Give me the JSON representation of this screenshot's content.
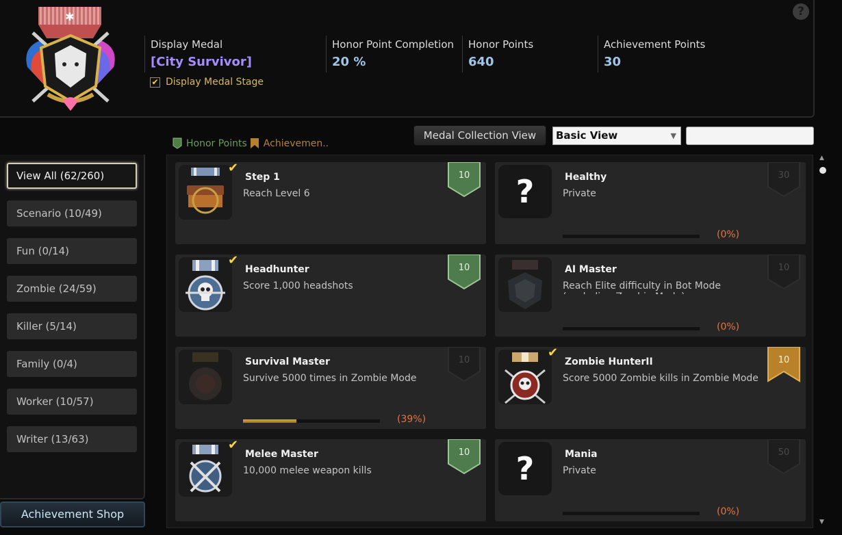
{
  "header": {
    "help_label": "?",
    "display_medal_label": "Display Medal",
    "display_medal_value": "[City Survivor]",
    "display_medal_stage_label": "Display Medal Stage",
    "display_medal_stage_checked": true,
    "honor_completion_label": "Honor Point Completion",
    "honor_completion_value": "20 %",
    "honor_points_label": "Honor Points",
    "honor_points_value": "640",
    "achievement_points_label": "Achievement Points",
    "achievement_points_value": "30"
  },
  "toolbar": {
    "legend_honor": "Honor Points",
    "legend_achievement": "Achievemen..",
    "collection_view_label": "Medal Collection View",
    "view_select_value": "Basic View",
    "search_placeholder": ""
  },
  "sidebar": {
    "categories": [
      {
        "label": "View All (62/260)",
        "active": true
      },
      {
        "label": "Scenario (10/49)"
      },
      {
        "label": "Fun (0/14)"
      },
      {
        "label": "Zombie (24/59)"
      },
      {
        "label": "Killer (5/14)"
      },
      {
        "label": "Family (0/4)"
      },
      {
        "label": "Worker (10/57)"
      },
      {
        "label": "Writer (13/63)"
      }
    ],
    "shop_label": "Achievement Shop"
  },
  "achievements": [
    {
      "title": "Step 1",
      "desc": "Reach Level 6",
      "points": "10",
      "ribbon": "green",
      "completed": true,
      "icon": "welcome-csnz-medal-icon",
      "progress": null,
      "progress_text": ""
    },
    {
      "title": "Healthy",
      "desc": "Private",
      "points": "30",
      "ribbon": "dark",
      "completed": false,
      "icon": "question-mark-icon",
      "progress": 0,
      "progress_text": "(0%)"
    },
    {
      "title": "Headhunter",
      "desc": "Score 1,000 headshots",
      "points": "10",
      "ribbon": "green",
      "completed": true,
      "icon": "skull-medal-icon",
      "progress": null,
      "progress_text": ""
    },
    {
      "title": "AI Master",
      "desc": "Reach Elite difficulty in Bot Mode (excluding Zombie Mode)",
      "points": "10",
      "ribbon": "dark",
      "completed": false,
      "icon": "wolf-medal-icon",
      "progress": 0,
      "progress_text": "(0%)"
    },
    {
      "title": "Survival Master",
      "desc": "Survive 5000 times in Zombie Mode",
      "points": "10",
      "ribbon": "dark",
      "completed": false,
      "icon": "survival-medal-icon",
      "progress": 39,
      "progress_text": "(39%)"
    },
    {
      "title": "Zombie HunterII",
      "desc": "Score 5000 Zombie kills in Zombie Mode",
      "points": "10",
      "ribbon": "gold",
      "completed": true,
      "icon": "zombie-skull-medal-icon",
      "progress": null,
      "progress_text": ""
    },
    {
      "title": "Melee Master",
      "desc": "10,000 melee weapon kills",
      "points": "10",
      "ribbon": "green",
      "completed": true,
      "icon": "crossed-blades-medal-icon",
      "progress": null,
      "progress_text": ""
    },
    {
      "title": "Mania",
      "desc": "Private",
      "points": "50",
      "ribbon": "dark",
      "completed": false,
      "icon": "question-mark-icon",
      "progress": 0,
      "progress_text": "(0%)"
    }
  ]
}
